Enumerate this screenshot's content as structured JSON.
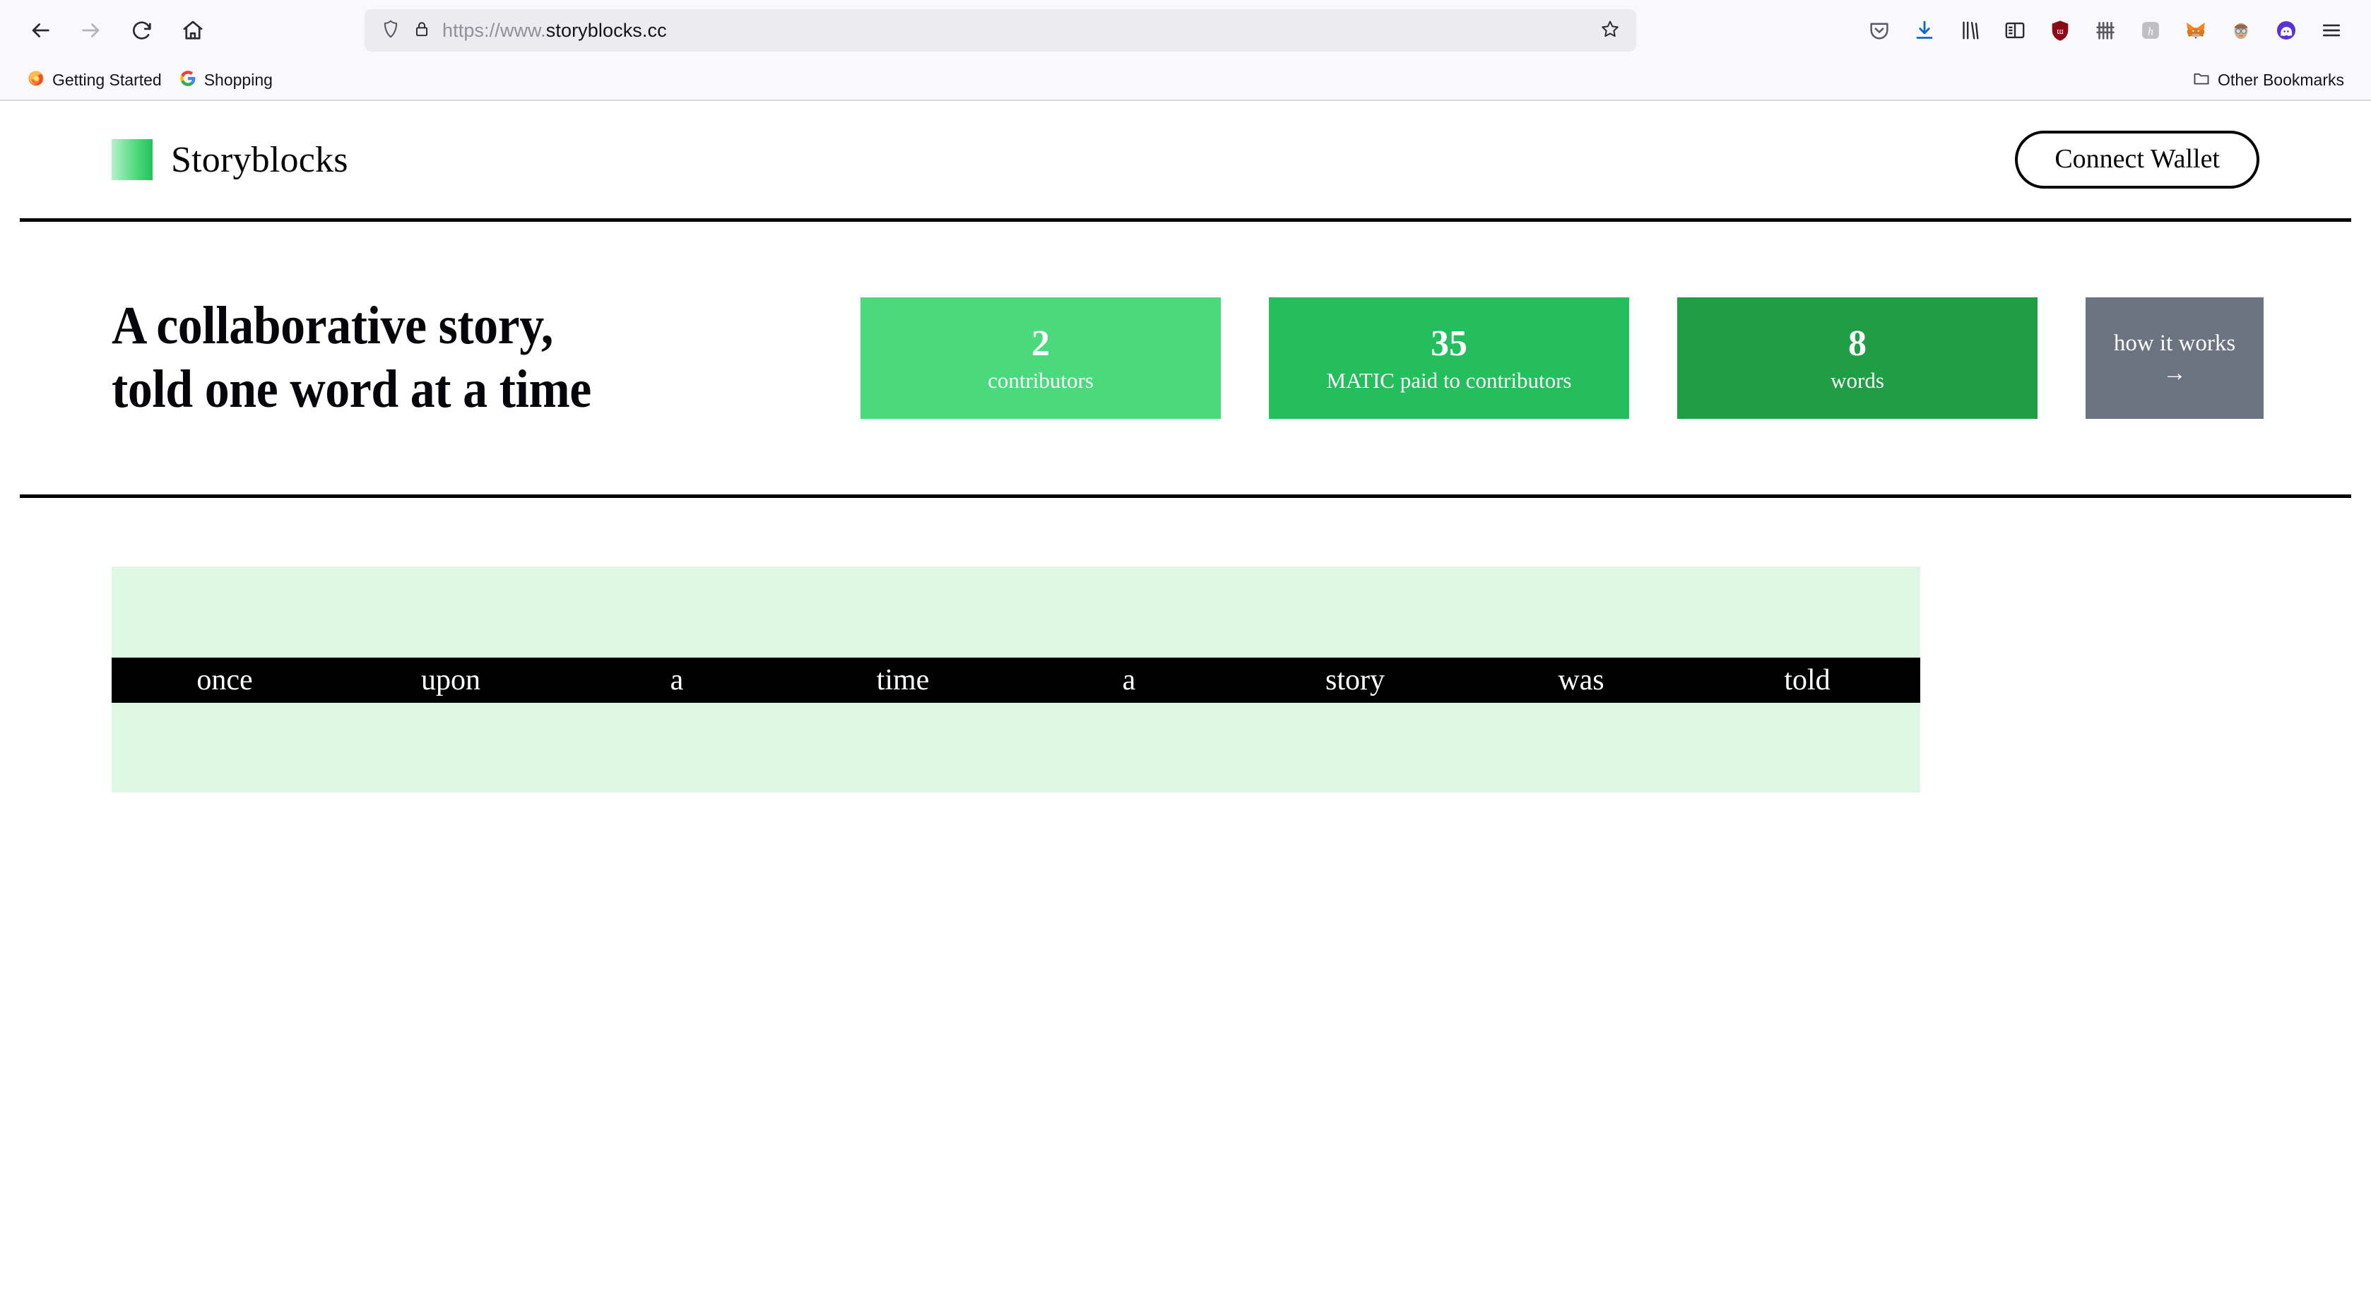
{
  "browser": {
    "nav": {
      "back": "back-arrow",
      "forward": "forward-arrow",
      "reload": "reload-arrow",
      "home": "home-house"
    },
    "url": {
      "scheme": "https://www.",
      "domain": "storyblocks.cc",
      "full": "https://www.storyblocks.cc",
      "shield_icon": "tracking-protection-shield",
      "lock_icon": "padlock-secure",
      "bookmark_icon": "star-outline"
    },
    "toolbar_icons": [
      "pocket-icon",
      "downloads-icon",
      "library-icon",
      "sidebar-icon",
      "ublock-origin-icon",
      "fence-extension-icon",
      "honey-icon",
      "metamask-fox-icon",
      "avatar-extension-icon",
      "ghost-wallet-icon",
      "app-menu-icon"
    ],
    "bookmarks": [
      {
        "label": "Getting Started",
        "icon": "firefox-icon"
      },
      {
        "label": "Shopping",
        "icon": "google-icon"
      }
    ],
    "other_bookmarks": {
      "label": "Other Bookmarks",
      "icon": "folder-icon"
    }
  },
  "site": {
    "brand": {
      "name": "Storyblocks",
      "mark_gradient_from": "#b6f0c9",
      "mark_gradient_to": "#22c25c"
    },
    "connect_wallet_label": "Connect Wallet",
    "headline": "A collaborative story,\ntold one word at a time",
    "stats": [
      {
        "value": "2",
        "label": "contributors",
        "color": "#4bd97d"
      },
      {
        "value": "35",
        "label": "MATIC paid to contributors",
        "color": "#25be5c"
      },
      {
        "value": "8",
        "label": "words",
        "color": "#1f9e45"
      }
    ],
    "how_it_works": {
      "label": "how it works",
      "arrow": "→",
      "color": "#6b7280"
    },
    "story": {
      "panel_color": "#ddf7e3",
      "band_color": "#000000",
      "words": [
        "once",
        "upon",
        "a",
        "time",
        "a",
        "story",
        "was",
        "told"
      ]
    }
  }
}
